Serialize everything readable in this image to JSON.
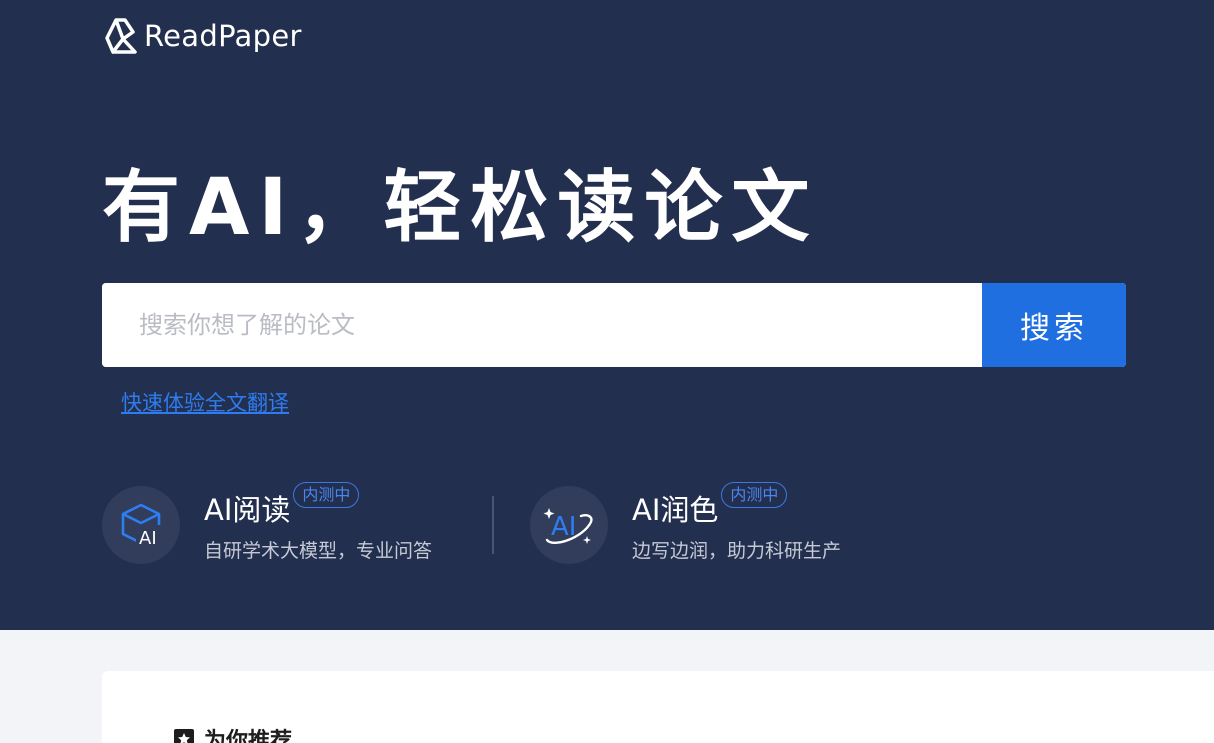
{
  "brand": {
    "name": "ReadPaper"
  },
  "hero": {
    "title": "有AI，轻松读论文"
  },
  "search": {
    "placeholder": "搜索你想了解的论文",
    "button_label": "搜索"
  },
  "quick_link": {
    "label": "快速体验全文翻译"
  },
  "features": [
    {
      "title": "AI阅读",
      "badge": "内测中",
      "subtitle": "自研学术大模型，专业问答",
      "icon_text": "AI"
    },
    {
      "title": "AI润色",
      "badge": "内测中",
      "subtitle": "边写边润，助力科研生产",
      "icon_text": "AI"
    }
  ],
  "recommend": {
    "heading": "为你推荐"
  },
  "colors": {
    "hero_bg": "#232f4e",
    "accent": "#1f6fe0",
    "link": "#2e7cf0",
    "badge": "#3a78e4"
  }
}
